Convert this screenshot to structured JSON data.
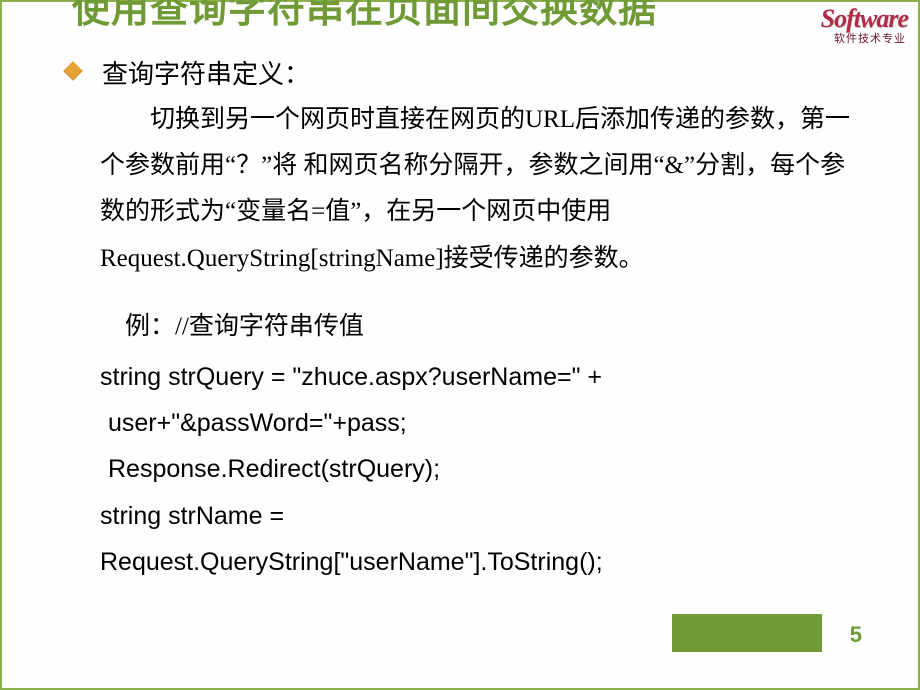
{
  "logo": {
    "main": "Software",
    "sub": "软件技术专业"
  },
  "title": "使用查询字符串在页面间交换数据",
  "section_heading": "查询字符串定义：",
  "paragraph": "切换到另一个网页时直接在网页的URL后添加传递的参数，第一个参数前用“？”将 和网页名称分隔开，参数之间用“&”分割，每个参数的形式为“变量名=值”，在另一个网页中使用Request.QueryString[stringName]接受传递的参数。",
  "example_label": "例：//查询字符串传值",
  "code": {
    "line1": "string strQuery = \"zhuce.aspx?userName=\" +",
    "line2": "user+\"&passWord=\"+pass;",
    "line3": "Response.Redirect(strQuery);",
    "line4": " string strName =",
    "line5": "Request.QueryString[\"userName\"].ToString();"
  },
  "page_number": "5"
}
